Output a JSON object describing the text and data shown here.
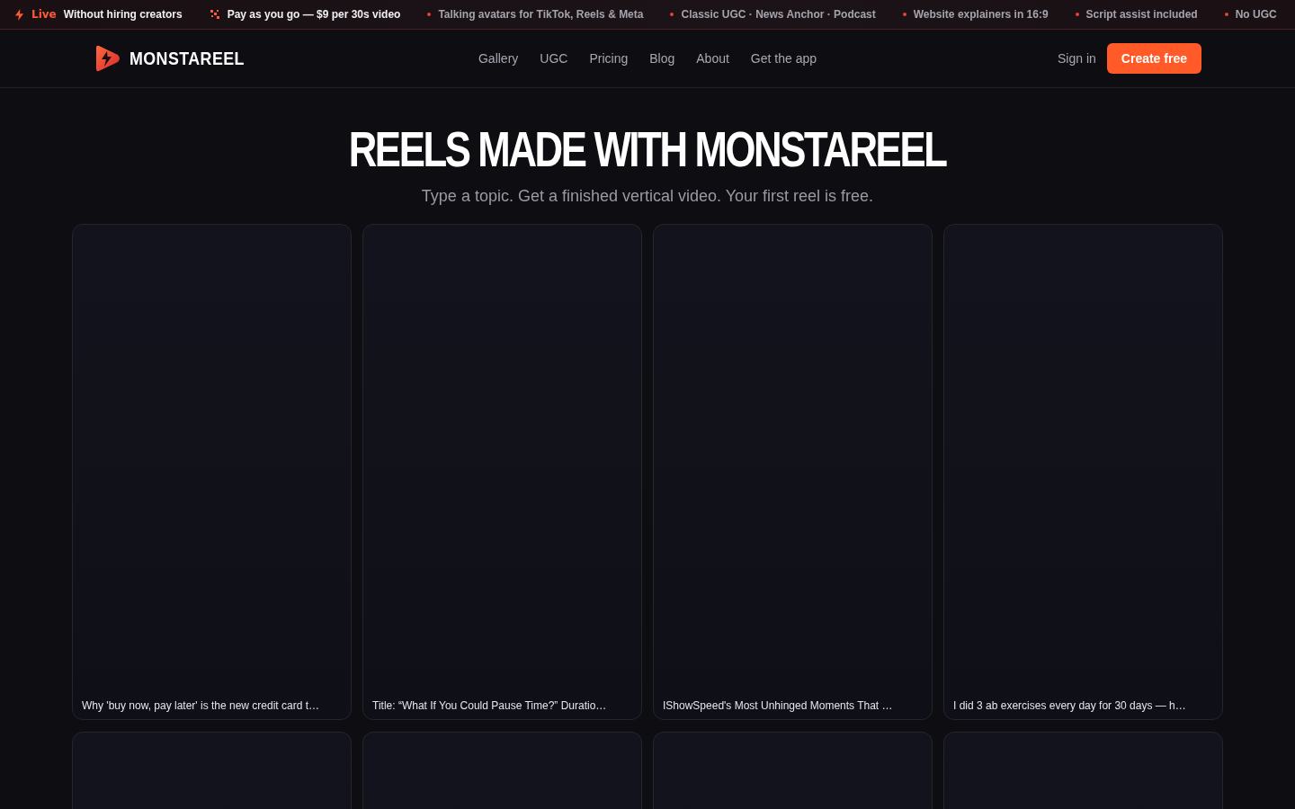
{
  "ticker": [
    {
      "kind": "live",
      "badge": "Live",
      "text": "Without hiring creators"
    },
    {
      "kind": "sparkle",
      "text": "Pay as you go — $9 per 30s video"
    },
    {
      "kind": "dot",
      "text": "Talking avatars for TikTok, Reels & Meta"
    },
    {
      "kind": "dot",
      "text": "Classic UGC · News Anchor · Podcast"
    },
    {
      "kind": "dot",
      "text": "Website explainers in 16:9"
    },
    {
      "kind": "dot",
      "text": "Script assist included"
    },
    {
      "kind": "dot",
      "text": "No UGC"
    }
  ],
  "header": {
    "brand": "MONSTAREEL",
    "nav": [
      "Gallery",
      "UGC",
      "Pricing",
      "Blog",
      "About",
      "Get the app"
    ],
    "sign_in": "Sign in",
    "cta": "Create free"
  },
  "hero": {
    "title": "REELS MADE WITH MONSTAREEL",
    "subtitle": "Type a topic. Get a finished vertical video. Your first reel is free."
  },
  "cards": [
    {
      "caption": "Why 'buy now, pay later' is the new credit card t…"
    },
    {
      "caption": "Title: “What If You Could Pause Time?” Duratio…"
    },
    {
      "caption": "IShowSpeed's Most Unhinged Moments That …"
    },
    {
      "caption": "I did 3 ab exercises every day for 30 days — h…"
    },
    {
      "kind": "video"
    },
    {
      "kind": "video"
    },
    {
      "kind": "video"
    },
    {
      "kind": "video"
    }
  ]
}
